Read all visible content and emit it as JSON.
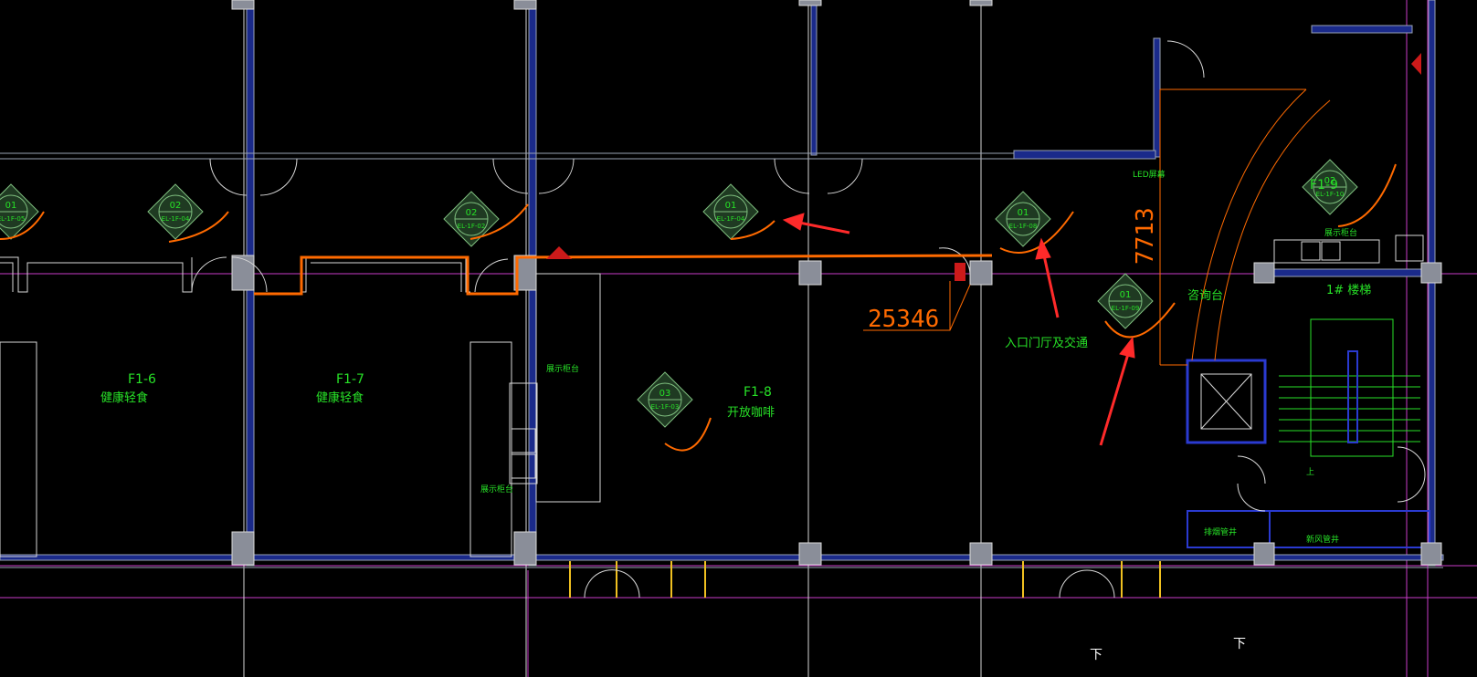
{
  "rooms": [
    {
      "code": "F1-6",
      "name": "健康轻食"
    },
    {
      "code": "F1-7",
      "name": "健康轻食"
    },
    {
      "code": "F1-8",
      "name": "开放咖啡"
    },
    {
      "code": "F1-9",
      "name": ""
    }
  ],
  "labels": {
    "consult_desk": "咨询台",
    "stair": "1# 楼梯",
    "led": "LED屏幕",
    "entrance_note": "入口门厅及交通",
    "counter_1": "展示柜台",
    "counter_2": "展示柜台",
    "top_counter": "展示柜台",
    "vent_1": "排烟管井",
    "vent_2": "新风管井",
    "down_1": "下",
    "down_2": "下",
    "up": "上"
  },
  "dimensions": {
    "length_25346": "25346",
    "length_7713": "7713"
  },
  "elevation_tags": [
    {
      "num": "01",
      "ref": "EL-1F-05"
    },
    {
      "num": "02",
      "ref": "EL-1F-04"
    },
    {
      "num": "02",
      "ref": "EL-1F-02"
    },
    {
      "num": "01",
      "ref": "EL-1F-04"
    },
    {
      "num": "01",
      "ref": "EL-1F-08"
    },
    {
      "num": "01",
      "ref": "EL-1F-09"
    },
    {
      "num": "03",
      "ref": "EL-1F-03"
    },
    {
      "num": "02",
      "ref": "EL-1F-10"
    }
  ],
  "colors": {
    "background": "#000000",
    "wall": "#9aa3b5",
    "wall_blue": "#2a3ad0",
    "green_text": "#27e127",
    "orange": "#ff6a00",
    "red": "#ff2a2a",
    "magenta": "#c83cc8",
    "tag_fill": "#1f3a22"
  }
}
